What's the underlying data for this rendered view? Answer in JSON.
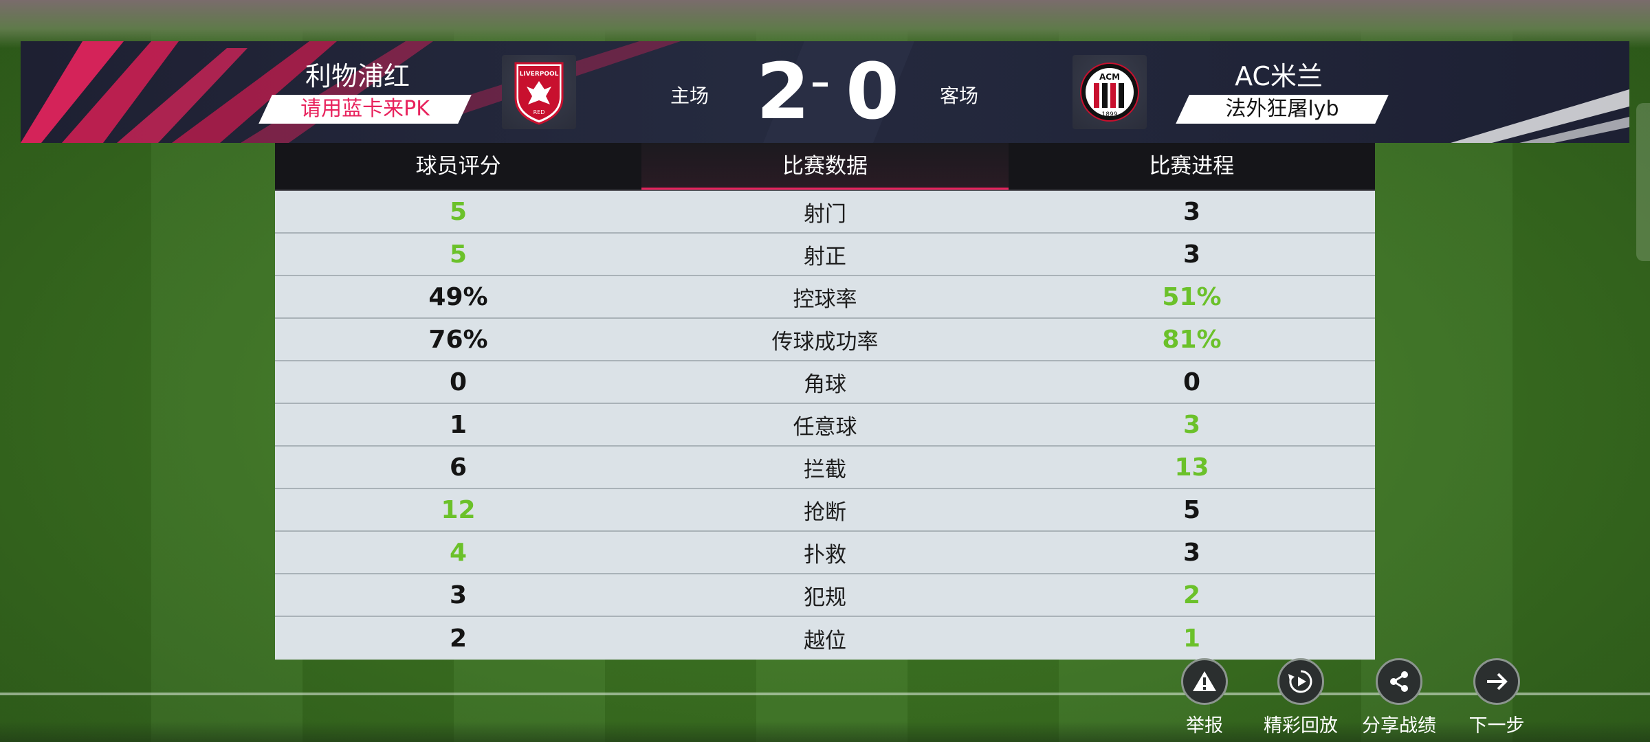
{
  "match": {
    "home": {
      "team": "利物浦红",
      "player": "请用蓝卡来PK",
      "crest": "liverpool-crest",
      "crest_text": "LIVERPOOL",
      "crest_sub": "RED"
    },
    "away": {
      "team": "AC米兰",
      "player": "法外狂屠lyb",
      "crest": "ac-milan-crest",
      "crest_text": "ACM",
      "crest_sub": "1899"
    },
    "home_label": "主场",
    "away_label": "客场",
    "home_score": "2",
    "away_score": "0"
  },
  "tabs": [
    {
      "label": "球员评分",
      "active": false
    },
    {
      "label": "比赛数据",
      "active": true
    },
    {
      "label": "比赛进程",
      "active": false
    }
  ],
  "stats": [
    {
      "label": "射门",
      "home": "5",
      "away": "3",
      "home_good": true,
      "away_good": false
    },
    {
      "label": "射正",
      "home": "5",
      "away": "3",
      "home_good": true,
      "away_good": false
    },
    {
      "label": "控球率",
      "home": "49%",
      "away": "51%",
      "home_good": false,
      "away_good": true
    },
    {
      "label": "传球成功率",
      "home": "76%",
      "away": "81%",
      "home_good": false,
      "away_good": true
    },
    {
      "label": "角球",
      "home": "0",
      "away": "0",
      "home_good": false,
      "away_good": false
    },
    {
      "label": "任意球",
      "home": "1",
      "away": "3",
      "home_good": false,
      "away_good": true
    },
    {
      "label": "拦截",
      "home": "6",
      "away": "13",
      "home_good": false,
      "away_good": true
    },
    {
      "label": "抢断",
      "home": "12",
      "away": "5",
      "home_good": true,
      "away_good": false
    },
    {
      "label": "扑救",
      "home": "4",
      "away": "3",
      "home_good": true,
      "away_good": false
    },
    {
      "label": "犯规",
      "home": "3",
      "away": "2",
      "home_good": false,
      "away_good": true
    },
    {
      "label": "越位",
      "home": "2",
      "away": "1",
      "home_good": false,
      "away_good": true
    }
  ],
  "actions": [
    {
      "label": "举报",
      "icon": "warning-icon"
    },
    {
      "label": "精彩回放",
      "icon": "replay-icon"
    },
    {
      "label": "分享战绩",
      "icon": "share-icon"
    },
    {
      "label": "下一步",
      "icon": "arrow-right-icon"
    }
  ],
  "colors": {
    "accent": "#e8235d",
    "good": "#6bc12a",
    "banner": "#1e2032"
  }
}
